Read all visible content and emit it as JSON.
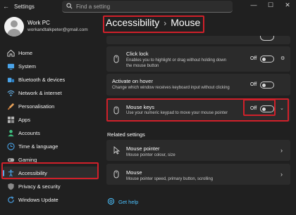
{
  "window": {
    "app_title": "Settings",
    "back": "←",
    "minimize": "—",
    "maximize": "☐",
    "close": "✕"
  },
  "search": {
    "placeholder": "Find a setting"
  },
  "profile": {
    "name": "Work PC",
    "email": "workandtalkpeter@gmail.com"
  },
  "sidebar": {
    "items": [
      {
        "label": "Home",
        "icon": "home-icon",
        "color": "#e0e0e0"
      },
      {
        "label": "System",
        "icon": "monitor-icon",
        "color": "#4aa3e8"
      },
      {
        "label": "Bluetooth & devices",
        "icon": "bluetooth-devices-icon",
        "color": "#4aa3e8"
      },
      {
        "label": "Network & internet",
        "icon": "wifi-icon",
        "color": "#6ab8f0"
      },
      {
        "label": "Personalisation",
        "icon": "paintbrush-icon",
        "color": "#e8a25a"
      },
      {
        "label": "Apps",
        "icon": "apps-icon",
        "color": "#b0b0b0"
      },
      {
        "label": "Accounts",
        "icon": "person-icon",
        "color": "#3fbf7f"
      },
      {
        "label": "Time & language",
        "icon": "globe-clock-icon",
        "color": "#4aa3e8"
      },
      {
        "label": "Gaming",
        "icon": "gamepad-icon",
        "color": "#b0b0b0"
      },
      {
        "label": "Accessibility",
        "icon": "accessibility-icon",
        "color": "#4aa3e8"
      },
      {
        "label": "Privacy & security",
        "icon": "shield-icon",
        "color": "#8a8a8a"
      },
      {
        "label": "Windows Update",
        "icon": "update-icon",
        "color": "#4aa3e8"
      }
    ],
    "active_index": 9
  },
  "breadcrumb": {
    "parent": "Accessibility",
    "separator": "›",
    "current": "Mouse"
  },
  "settings": {
    "click_lock": {
      "title": "Click lock",
      "desc": "Enables you to highlight or drag without holding down the mouse button",
      "state": "Off"
    },
    "activate_on_hover": {
      "title": "Activate on hover",
      "desc": "Change which window receives keyboard input without clicking",
      "state": "Off"
    },
    "mouse_keys": {
      "title": "Mouse keys",
      "desc": "Use your numeric keypad to move your mouse pointer",
      "state": "Off"
    }
  },
  "related": {
    "heading": "Related settings",
    "items": [
      {
        "title": "Mouse pointer",
        "desc": "Mouse pointer colour, size"
      },
      {
        "title": "Mouse",
        "desc": "Mouse pointer speed, primary button, scrolling"
      }
    ]
  },
  "help": {
    "label": "Get help"
  },
  "colors": {
    "accent": "#4cc2ff",
    "highlight": "#d0202a",
    "background": "#202020",
    "card": "#2b2b2b"
  }
}
